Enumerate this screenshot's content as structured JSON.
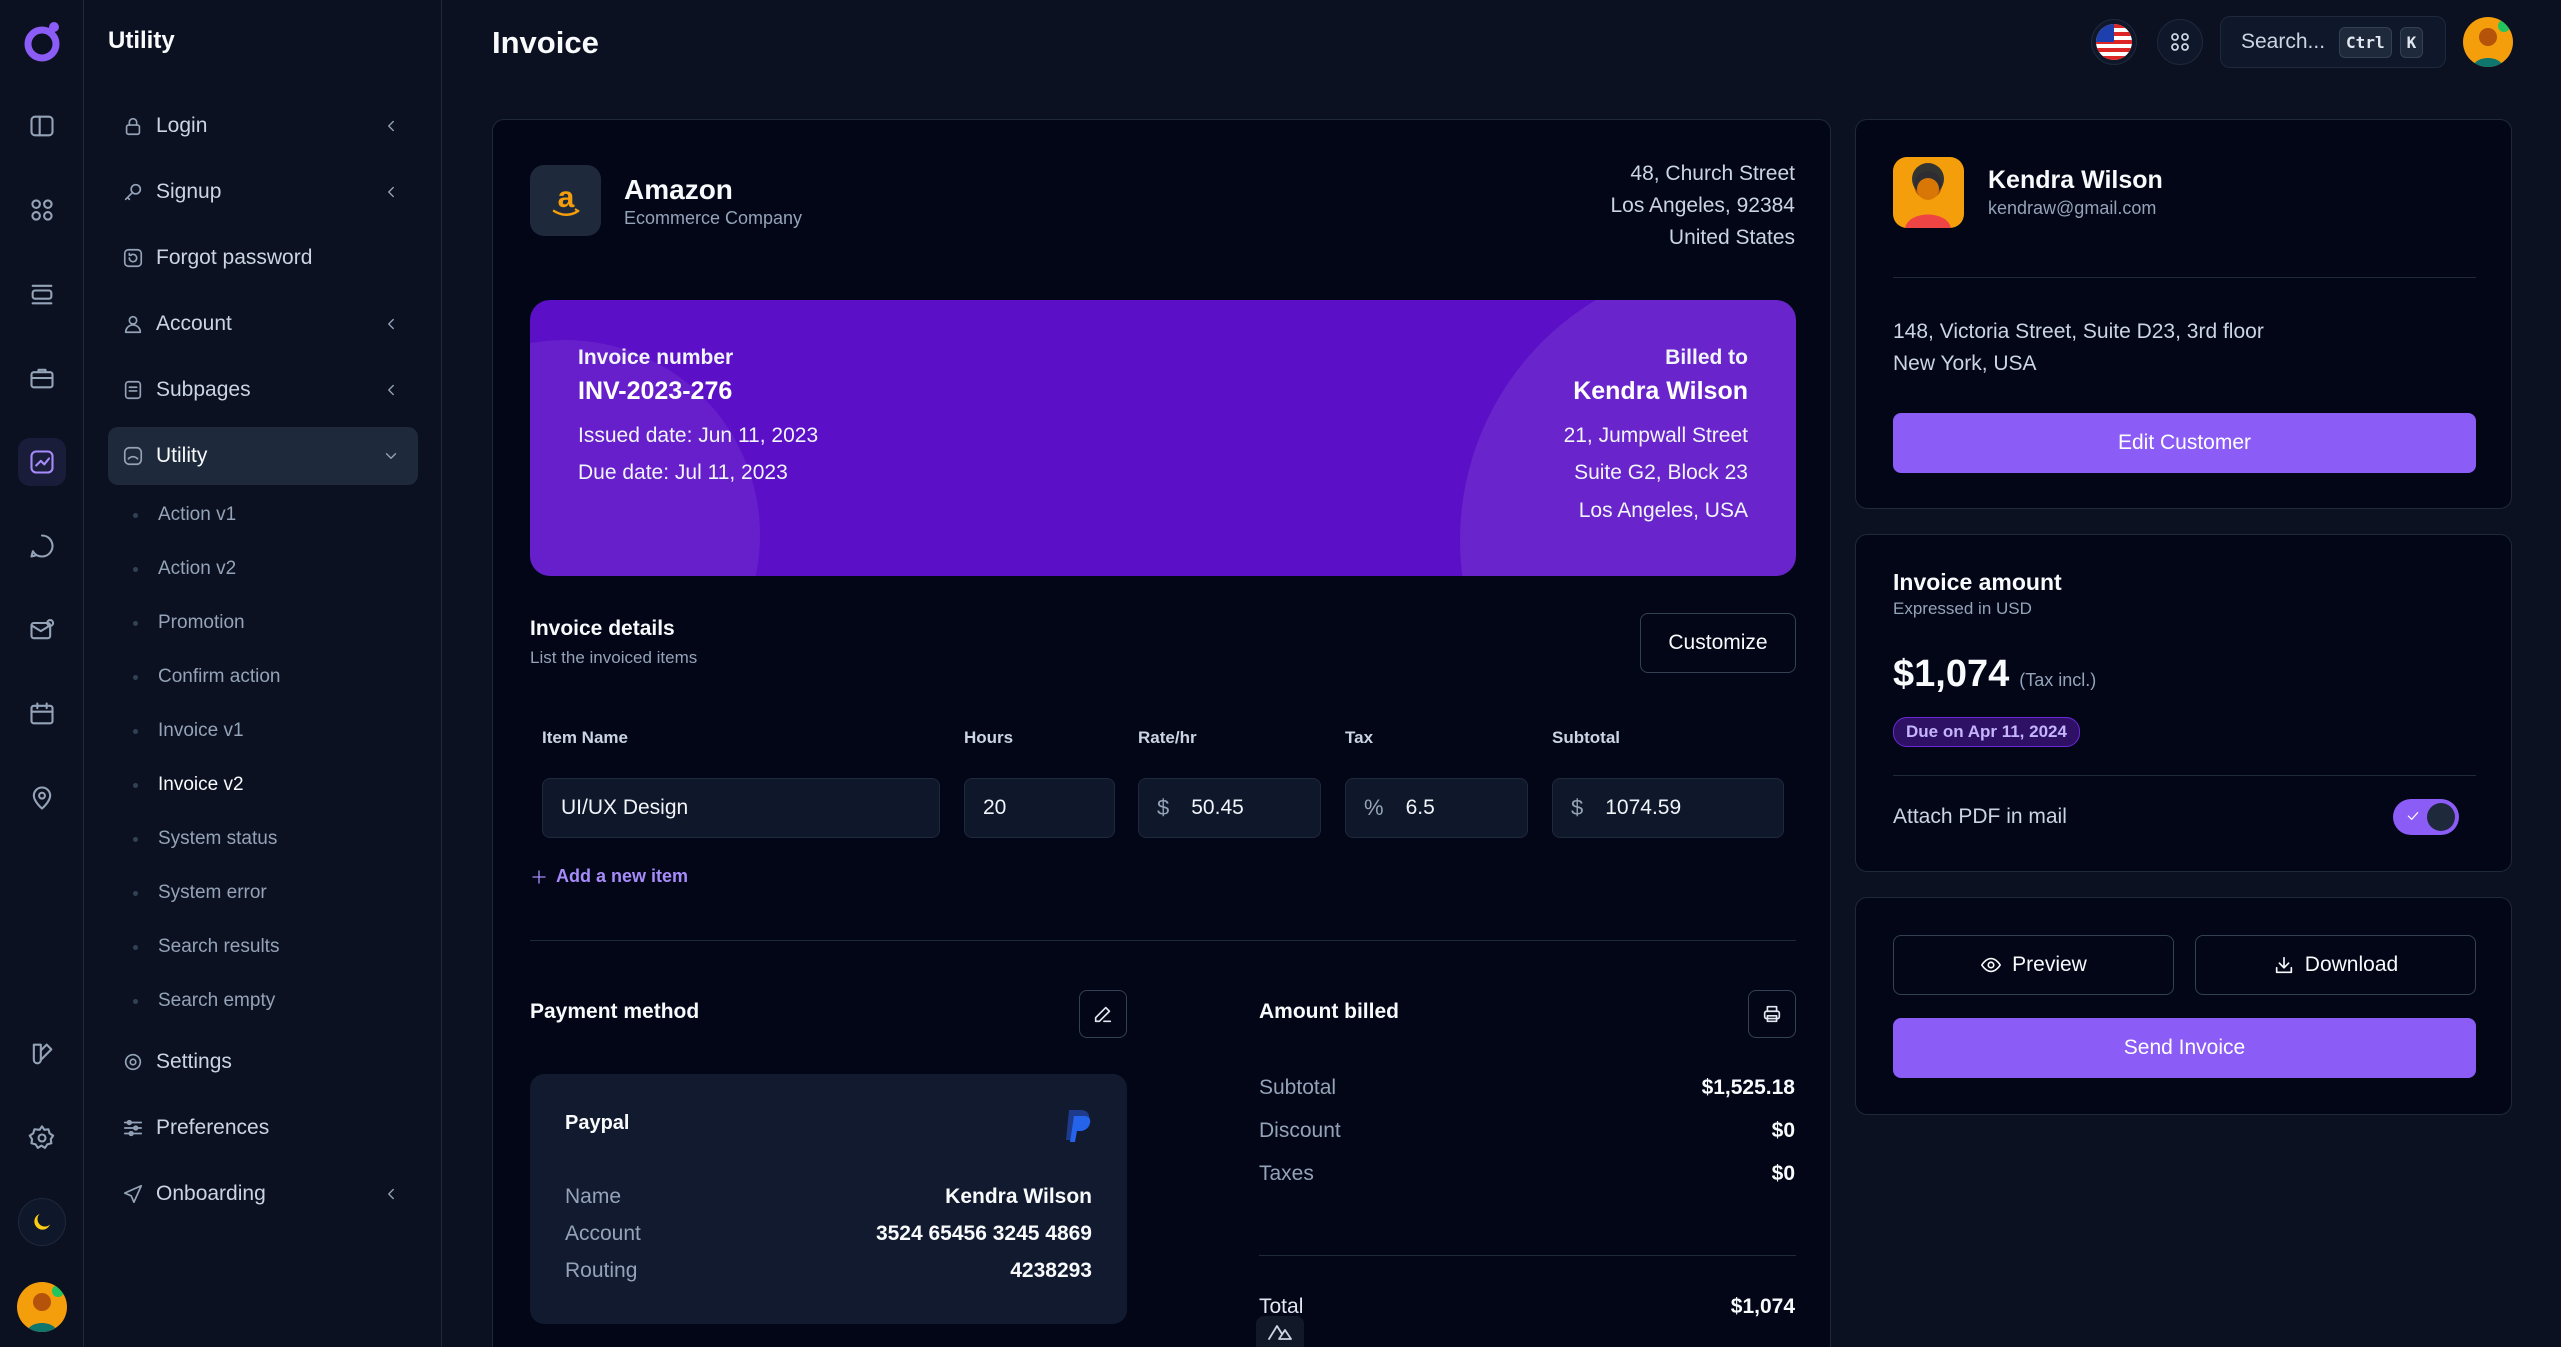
{
  "colors": {
    "accent": "#8b5cf6",
    "banner": "#5b0fc7",
    "background": "#0b1120",
    "card": "#020617"
  },
  "rail": {
    "icons": [
      "logo-icon",
      "sidebar-toggle-icon",
      "grid-icon",
      "layers-icon",
      "briefcase-icon",
      "chart-icon",
      "chat-icon",
      "mail-icon",
      "calendar-icon",
      "map-pin-icon",
      "brush-icon",
      "settings-icon",
      "moon-icon",
      "avatar"
    ]
  },
  "sidebar": {
    "title": "Utility",
    "items": [
      {
        "label": "Login",
        "icon": "lock-icon"
      },
      {
        "label": "Signup",
        "icon": "key-icon"
      },
      {
        "label": "Forgot password",
        "icon": "reset-icon"
      },
      {
        "label": "Account",
        "icon": "user-icon"
      },
      {
        "label": "Subpages",
        "icon": "document-icon"
      },
      {
        "label": "Utility",
        "icon": "utility-icon"
      },
      {
        "label": "Settings",
        "icon": "gear-icon"
      },
      {
        "label": "Preferences",
        "icon": "sliders-icon"
      },
      {
        "label": "Onboarding",
        "icon": "send-icon"
      }
    ],
    "sub_items": [
      "Action v1",
      "Action v2",
      "Promotion",
      "Confirm action",
      "Invoice v1",
      "Invoice v2",
      "System status",
      "System error",
      "Search results",
      "Search empty"
    ],
    "active_sub": "Invoice v2"
  },
  "header": {
    "title": "Invoice",
    "search_placeholder": "Search...",
    "kbd_ctrl": "Ctrl",
    "kbd_k": "K"
  },
  "company": {
    "name": "Amazon",
    "type": "Ecommerce Company",
    "address": [
      "48, Church Street",
      "Los Angeles, 92384",
      "United States"
    ]
  },
  "banner": {
    "number_label": "Invoice number",
    "number": "INV-2023-276",
    "issued": "Issued date: Jun 11, 2023",
    "due": "Due date: Jul 11, 2023",
    "billed_label": "Billed to",
    "billed_name": "Kendra Wilson",
    "billed_address": [
      "21, Jumpwall Street",
      "Suite G2, Block 23",
      "Los Angeles, USA"
    ]
  },
  "details": {
    "title": "Invoice details",
    "subtitle": "List the invoiced items",
    "customize": "Customize",
    "columns": [
      "Item Name",
      "Hours",
      "Rate/hr",
      "Tax",
      "Subtotal"
    ],
    "row": {
      "item": "UI/UX Design",
      "hours": "20",
      "rate_prefix": "$",
      "rate": "50.45",
      "tax_prefix": "%",
      "tax": "6.5",
      "subtotal_prefix": "$",
      "subtotal": "1074.59"
    },
    "add_item": "Add a new item"
  },
  "payment": {
    "title": "Payment method",
    "provider": "Paypal",
    "rows": [
      {
        "k": "Name",
        "v": "Kendra Wilson"
      },
      {
        "k": "Account",
        "v": "3524 65456 3245 4869"
      },
      {
        "k": "Routing",
        "v": "4238293"
      }
    ]
  },
  "amount_billed": {
    "title": "Amount billed",
    "rows": [
      {
        "k": "Subtotal",
        "v": "$1,525.18"
      },
      {
        "k": "Discount",
        "v": "$0"
      },
      {
        "k": "Taxes",
        "v": "$0"
      }
    ],
    "total_label": "Total",
    "total": "$1,074"
  },
  "customer": {
    "name": "Kendra Wilson",
    "email": "kendraw@gmail.com",
    "address": [
      "148, Victoria Street, Suite D23, 3rd floor",
      "New York, USA"
    ],
    "edit": "Edit Customer"
  },
  "invoice_amount": {
    "title": "Invoice amount",
    "subtitle": "Expressed in USD",
    "amount": "$1,074",
    "tax_note": "(Tax incl.)",
    "due_badge": "Due on Apr 11, 2024",
    "attach_label": "Attach PDF in mail",
    "attach_enabled": true
  },
  "actions": {
    "preview": "Preview",
    "download": "Download",
    "send": "Send Invoice"
  }
}
